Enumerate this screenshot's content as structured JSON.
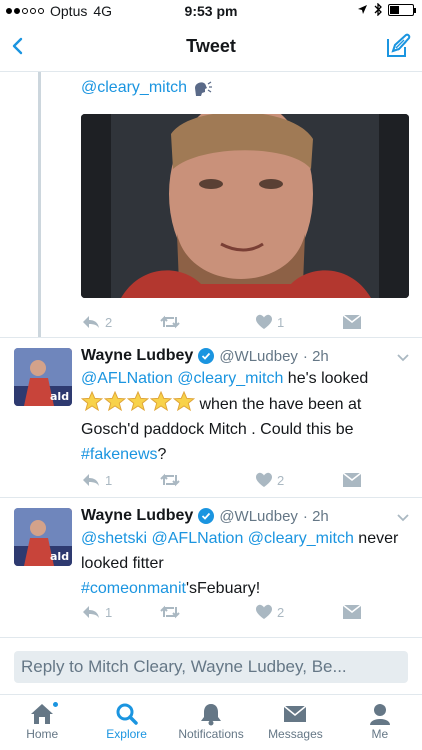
{
  "status_bar": {
    "carrier": "Optus",
    "network": "4G",
    "time": "9:53 pm"
  },
  "nav": {
    "title": "Tweet"
  },
  "tweets": [
    {
      "mention": "@cleary_mitch",
      "emoji": "speaking-head-icon",
      "actions": {
        "reply_count": "2",
        "retweet_count": "",
        "like_count": "1"
      }
    },
    {
      "name": "Wayne Ludbey",
      "handle": "@WLudbey",
      "time": "· 2h",
      "mention1": "@AFLNation",
      "mention2": "@cleary_mitch",
      "text1": " he's looked ",
      "text2": " when the have been at Gosch'd paddock Mitch . Could this be ",
      "hashtag": "#fakenews",
      "text3": "?",
      "actions": {
        "reply_count": "1",
        "retweet_count": "",
        "like_count": "2"
      }
    },
    {
      "name": "Wayne Ludbey",
      "handle": "@WLudbey",
      "time": "· 2h",
      "mention1": "@shetski",
      "mention2": "@AFLNation",
      "mention3": "@cleary_mitch",
      "text1": " never looked fitter",
      "hashtag": "#comeonmanit",
      "text2": "'sFebuary!",
      "actions": {
        "reply_count": "1",
        "retweet_count": "",
        "like_count": "2"
      }
    }
  ],
  "reply_bar": {
    "placeholder": "Reply to Mitch Cleary, Wayne Ludbey, Be..."
  },
  "tabs": [
    {
      "label": "Home",
      "icon": "home-icon"
    },
    {
      "label": "Explore",
      "icon": "search-icon",
      "active": true
    },
    {
      "label": "Notifications",
      "icon": "bell-icon"
    },
    {
      "label": "Messages",
      "icon": "envelope-icon"
    },
    {
      "label": "Me",
      "icon": "person-icon"
    }
  ],
  "colors": {
    "accent": "#1b95e0",
    "muted": "#aab8c2",
    "text": "#14171a",
    "secondary": "#657786"
  }
}
